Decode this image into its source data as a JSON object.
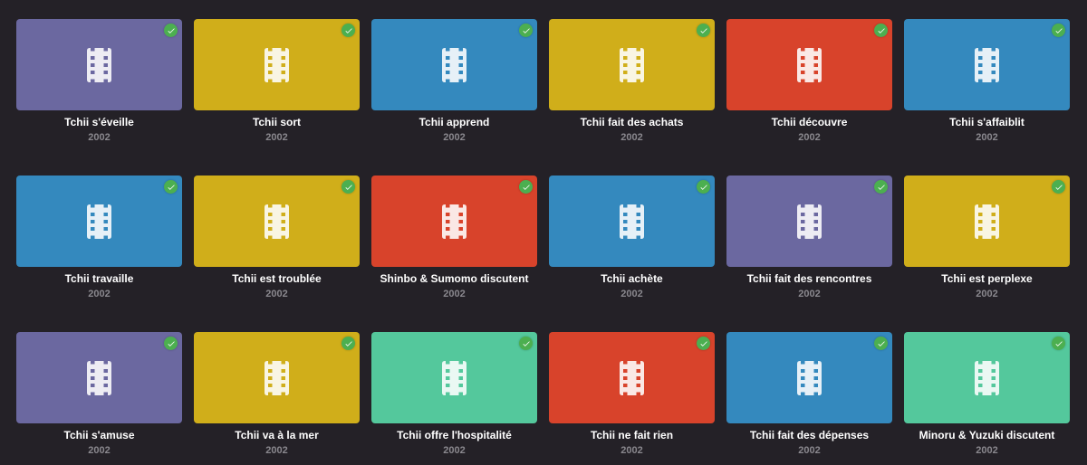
{
  "page": {
    "background": "#242127",
    "card_colors": {
      "purple": "#6b68a0",
      "yellow": "#d0ae1a",
      "blue": "#3489be",
      "red": "#d8432b",
      "green": "#54c89c"
    },
    "watched_badge_color": "#4caf50",
    "title_color": "#ffffff",
    "year_color": "#8a888e"
  },
  "icons": {
    "thumbnail_icon": "film-strip-icon",
    "watched_icon": "check-icon"
  },
  "cards": [
    {
      "title": "Tchii s'éveille",
      "year": "2002",
      "color": "purple",
      "watched": true
    },
    {
      "title": "Tchii sort",
      "year": "2002",
      "color": "yellow",
      "watched": true
    },
    {
      "title": "Tchii apprend",
      "year": "2002",
      "color": "blue",
      "watched": true
    },
    {
      "title": "Tchii fait des achats",
      "year": "2002",
      "color": "yellow",
      "watched": true
    },
    {
      "title": "Tchii découvre",
      "year": "2002",
      "color": "red",
      "watched": true
    },
    {
      "title": "Tchii s'affaiblit",
      "year": "2002",
      "color": "blue",
      "watched": true
    },
    {
      "title": "Tchii travaille",
      "year": "2002",
      "color": "blue",
      "watched": true
    },
    {
      "title": "Tchii est troublée",
      "year": "2002",
      "color": "yellow",
      "watched": true
    },
    {
      "title": "Shinbo & Sumomo discutent",
      "year": "2002",
      "color": "red",
      "watched": true
    },
    {
      "title": "Tchii achète",
      "year": "2002",
      "color": "blue",
      "watched": true
    },
    {
      "title": "Tchii fait des rencontres",
      "year": "2002",
      "color": "purple",
      "watched": true
    },
    {
      "title": "Tchii est perplexe",
      "year": "2002",
      "color": "yellow",
      "watched": true
    },
    {
      "title": "Tchii s'amuse",
      "year": "2002",
      "color": "purple",
      "watched": true
    },
    {
      "title": "Tchii va à la mer",
      "year": "2002",
      "color": "yellow",
      "watched": true
    },
    {
      "title": "Tchii offre l'hospitalité",
      "year": "2002",
      "color": "green",
      "watched": true
    },
    {
      "title": "Tchii ne fait rien",
      "year": "2002",
      "color": "red",
      "watched": true
    },
    {
      "title": "Tchii fait des dépenses",
      "year": "2002",
      "color": "blue",
      "watched": true
    },
    {
      "title": "Minoru & Yuzuki discutent",
      "year": "2002",
      "color": "green",
      "watched": true
    }
  ]
}
